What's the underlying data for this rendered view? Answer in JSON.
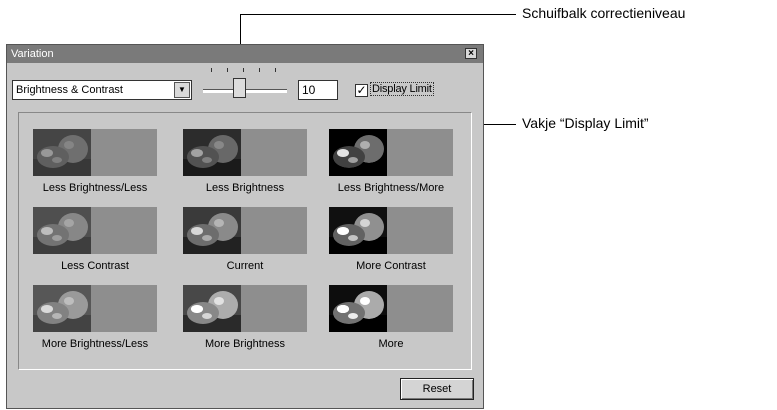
{
  "window": {
    "title": "Variation",
    "close_glyph": "×"
  },
  "controls": {
    "mode_select": {
      "value": "Brightness & Contrast",
      "arrow": "▼"
    },
    "correction_level": 10,
    "display_limit": {
      "label": "Display Limit",
      "checked": true,
      "check_glyph": "✓"
    }
  },
  "thumbnails": [
    {
      "label": "Less Brightness/Less",
      "variant": "dark-lowcontrast"
    },
    {
      "label": "Less Brightness",
      "variant": "dark"
    },
    {
      "label": "Less Brightness/More",
      "variant": "dark-highcontrast"
    },
    {
      "label": "Less Contrast",
      "variant": "lowcontrast"
    },
    {
      "label": "Current",
      "variant": "normal"
    },
    {
      "label": "More Contrast",
      "variant": "highcontrast"
    },
    {
      "label": "More Brightness/Less",
      "variant": "bright-lowcontrast"
    },
    {
      "label": "More Brightness",
      "variant": "bright"
    },
    {
      "label": "More",
      "variant": "bright-highcontrast"
    }
  ],
  "buttons": {
    "reset_label": "Reset"
  },
  "annotations": {
    "slider_callout": "Schuifbalk correctieniveau",
    "checkbox_callout": "Vakje “Display Limit”"
  }
}
